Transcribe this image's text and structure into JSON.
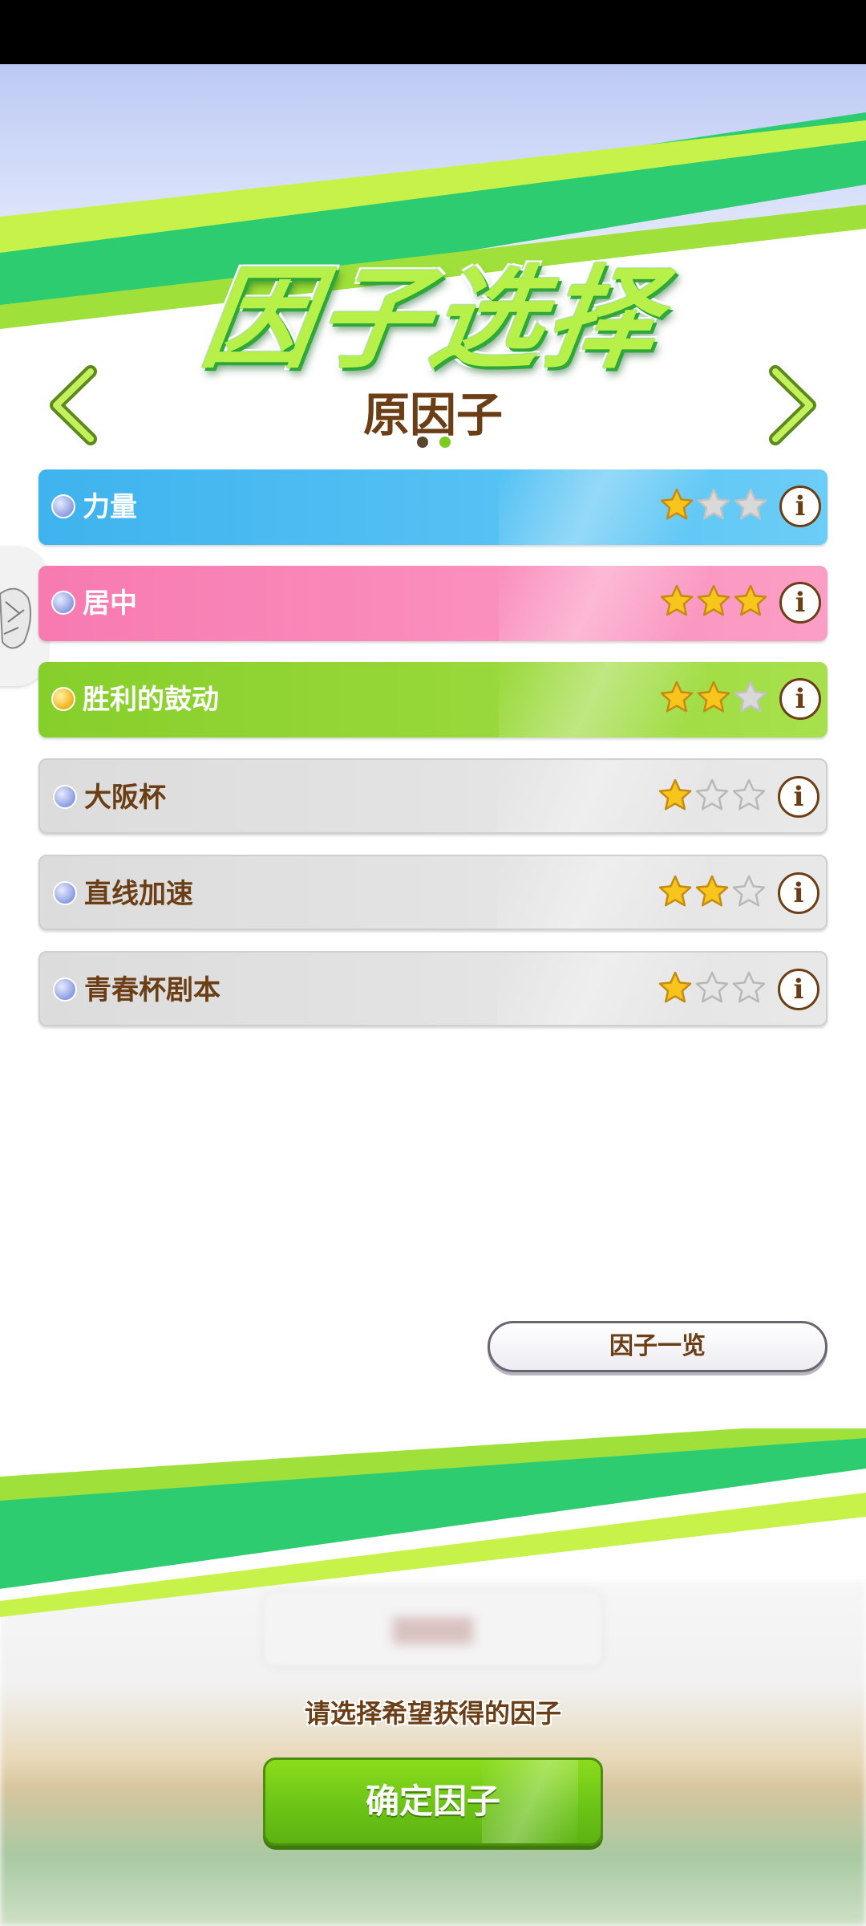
{
  "header": {
    "title": "因子选择"
  },
  "pager": {
    "subtitle": "原因子",
    "page_count": 2,
    "active_page": 2
  },
  "factors": [
    {
      "name": "力量",
      "color": "blue",
      "orb": "blue",
      "stars": 1,
      "max_stars": 3
    },
    {
      "name": "居中",
      "color": "pink",
      "orb": "blue",
      "stars": 3,
      "max_stars": 3
    },
    {
      "name": "胜利的鼓动",
      "color": "green",
      "orb": "gold",
      "stars": 2,
      "max_stars": 3
    },
    {
      "name": "大阪杯",
      "color": "gray",
      "orb": "blue",
      "stars": 1,
      "max_stars": 3
    },
    {
      "name": "直线加速",
      "color": "gray",
      "orb": "blue",
      "stars": 2,
      "max_stars": 3
    },
    {
      "name": "青春杯剧本",
      "color": "gray",
      "orb": "blue",
      "stars": 1,
      "max_stars": 3
    }
  ],
  "buttons": {
    "factor_list_label": "因子一览",
    "confirm_label": "确定因子"
  },
  "footer": {
    "prompt": "请选择希望获得的因子"
  },
  "colors": {
    "accent_green": "#7ccb1f",
    "text_brown": "#6b3e16",
    "row_blue": "#4bbaf1",
    "row_pink": "#f985b7",
    "row_green": "#8fd333",
    "row_gray": "#e0e0e0"
  },
  "icons": [
    "chevron-left-icon",
    "chevron-right-icon",
    "orb-icon",
    "star-icon",
    "info-icon"
  ]
}
